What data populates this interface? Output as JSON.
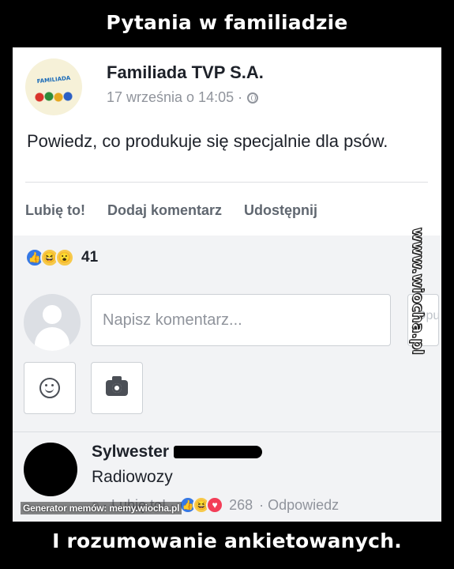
{
  "meme": {
    "top_caption": "Pytania w familiadzie",
    "bottom_caption": "I rozumowanie ankietowanych."
  },
  "post": {
    "page_logo_text": "FAMILIADA",
    "page_name": "Familiada TVP S.A.",
    "date": "17 września o 14:05 ·",
    "globe_icon": "globe-icon",
    "text": "Powiedz, co produkuje się specjalnie dla psów.",
    "actions": {
      "like": "Lubię to!",
      "comment": "Dodaj komentarz",
      "share": "Udostępnij"
    },
    "reaction_icons": [
      "like",
      "haha",
      "wow"
    ],
    "reaction_count": "41"
  },
  "compose": {
    "placeholder": "Napisz komentarz...",
    "post_button_partial": "Opu",
    "emoji_icon": "smiley-icon",
    "camera_icon": "camera-icon"
  },
  "comment": {
    "author": "Sylwester",
    "text": "Radiowozy",
    "footer_cut": "a",
    "footer_like": "· Lubię to! ·",
    "reaction_icons": [
      "like",
      "haha",
      "love"
    ],
    "reaction_count": "268",
    "reply": "· Odpowiedz"
  },
  "watermarks": {
    "generator": "Generator memów: memy.wiocha.pl",
    "side": "www.wiocha.pl"
  },
  "colors": {
    "like_blue": "#3578e5",
    "haha_yellow": "#f7c94a",
    "love_red": "#f33e58",
    "panel_bg": "#ffffff",
    "comments_bg": "#f2f3f5"
  }
}
